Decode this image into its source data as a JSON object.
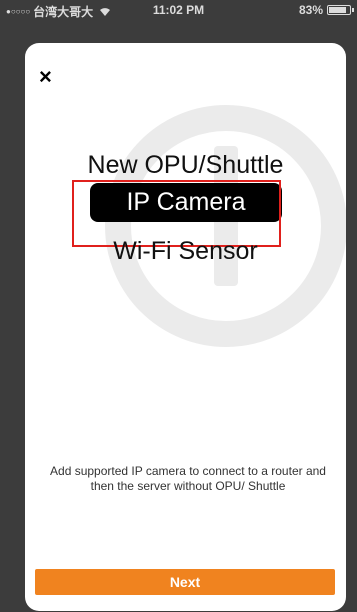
{
  "status_bar": {
    "carrier": "台湾大哥大",
    "time": "11:02 PM",
    "battery_text": "83%",
    "signal_icon": "signal-dots-icon",
    "wifi_icon": "wifi-icon",
    "battery_icon": "battery-icon",
    "battery_level": 0.83
  },
  "header": {
    "close_label": "×",
    "close_icon": "close-icon"
  },
  "options": {
    "opu_shuttle": "New OPU/Shuttle",
    "ip_camera": "IP Camera",
    "wifi_sensor": "Wi-Fi Sensor",
    "selected": "IP Camera"
  },
  "description": "Add supported IP camera to connect to a router and then the server without OPU/ Shuttle",
  "footer": {
    "next_label": "Next"
  },
  "colors": {
    "accent": "#f0831f",
    "selected_bg": "#000000",
    "highlight": "#e0201c",
    "backdrop": "#3c3c3c"
  }
}
